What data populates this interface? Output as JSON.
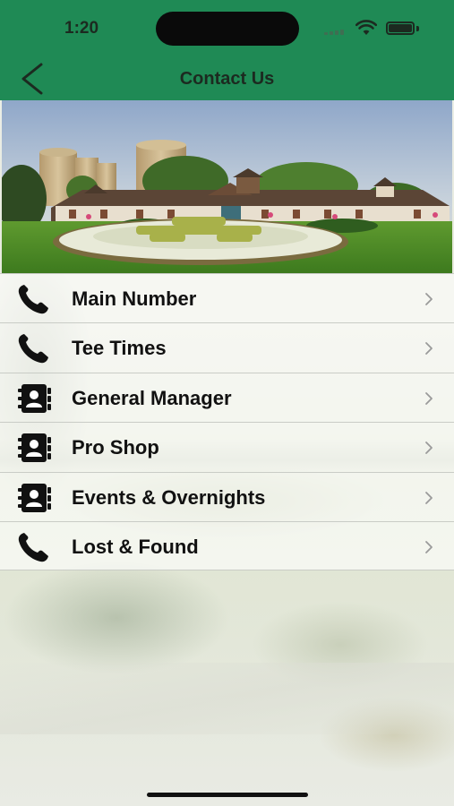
{
  "status_bar": {
    "time": "1:20"
  },
  "header": {
    "title": "Contact Us",
    "back_icon": "chevron-left-icon",
    "background_color": "#1f8a55"
  },
  "hero": {
    "description_icon": "clubhouse-photo"
  },
  "contacts": [
    {
      "label": "Main Number",
      "icon": "phone-icon"
    },
    {
      "label": "Tee Times",
      "icon": "phone-icon"
    },
    {
      "label": "General Manager",
      "icon": "contact-book-icon"
    },
    {
      "label": "Pro Shop",
      "icon": "contact-book-icon"
    },
    {
      "label": "Events & Overnights",
      "icon": "contact-book-icon"
    },
    {
      "label": "Lost & Found",
      "icon": "phone-icon"
    }
  ]
}
